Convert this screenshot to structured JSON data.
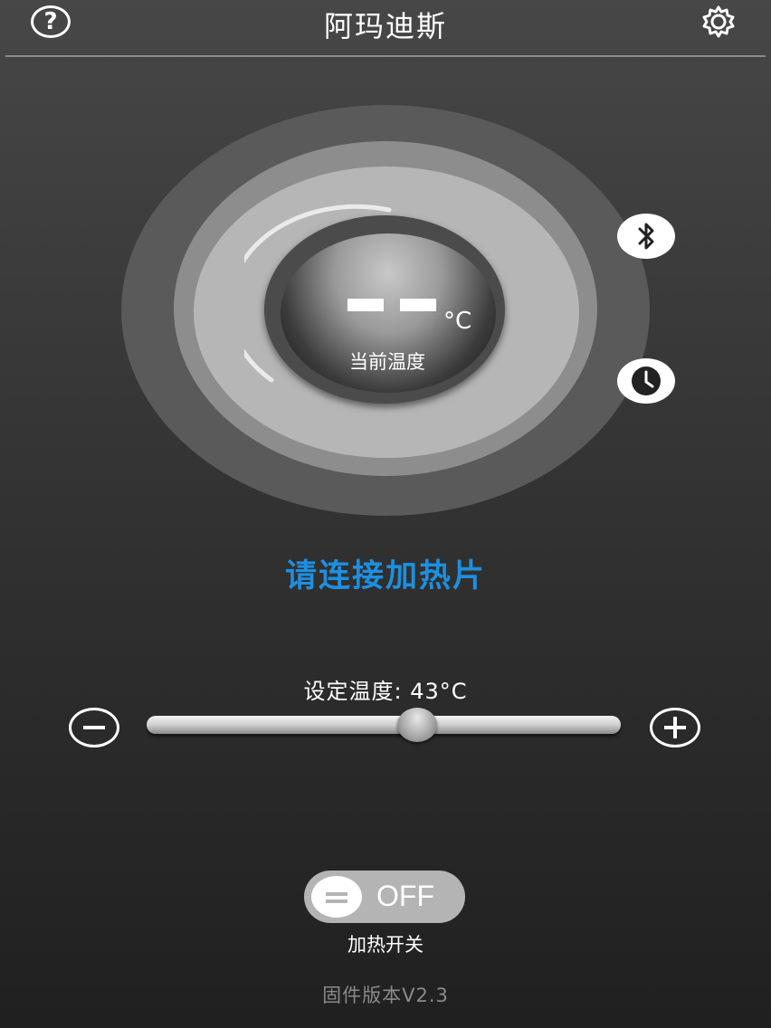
{
  "header": {
    "title": "阿玛迪斯"
  },
  "dial": {
    "current_value": "- -",
    "unit": "°C",
    "label": "当前温度"
  },
  "status": {
    "message": "请连接加热片",
    "color": "#1e8fe0"
  },
  "setpoint": {
    "label": "设定温度: 43°C",
    "value": 43,
    "slider_fraction": 0.57
  },
  "heater_switch": {
    "state": "OFF",
    "label": "加热开关"
  },
  "footer": {
    "firmware": "固件版本V2.3"
  },
  "icons": [
    "help-icon",
    "gear-icon",
    "bluetooth-icon",
    "clock-icon",
    "minus-icon",
    "plus-icon"
  ]
}
